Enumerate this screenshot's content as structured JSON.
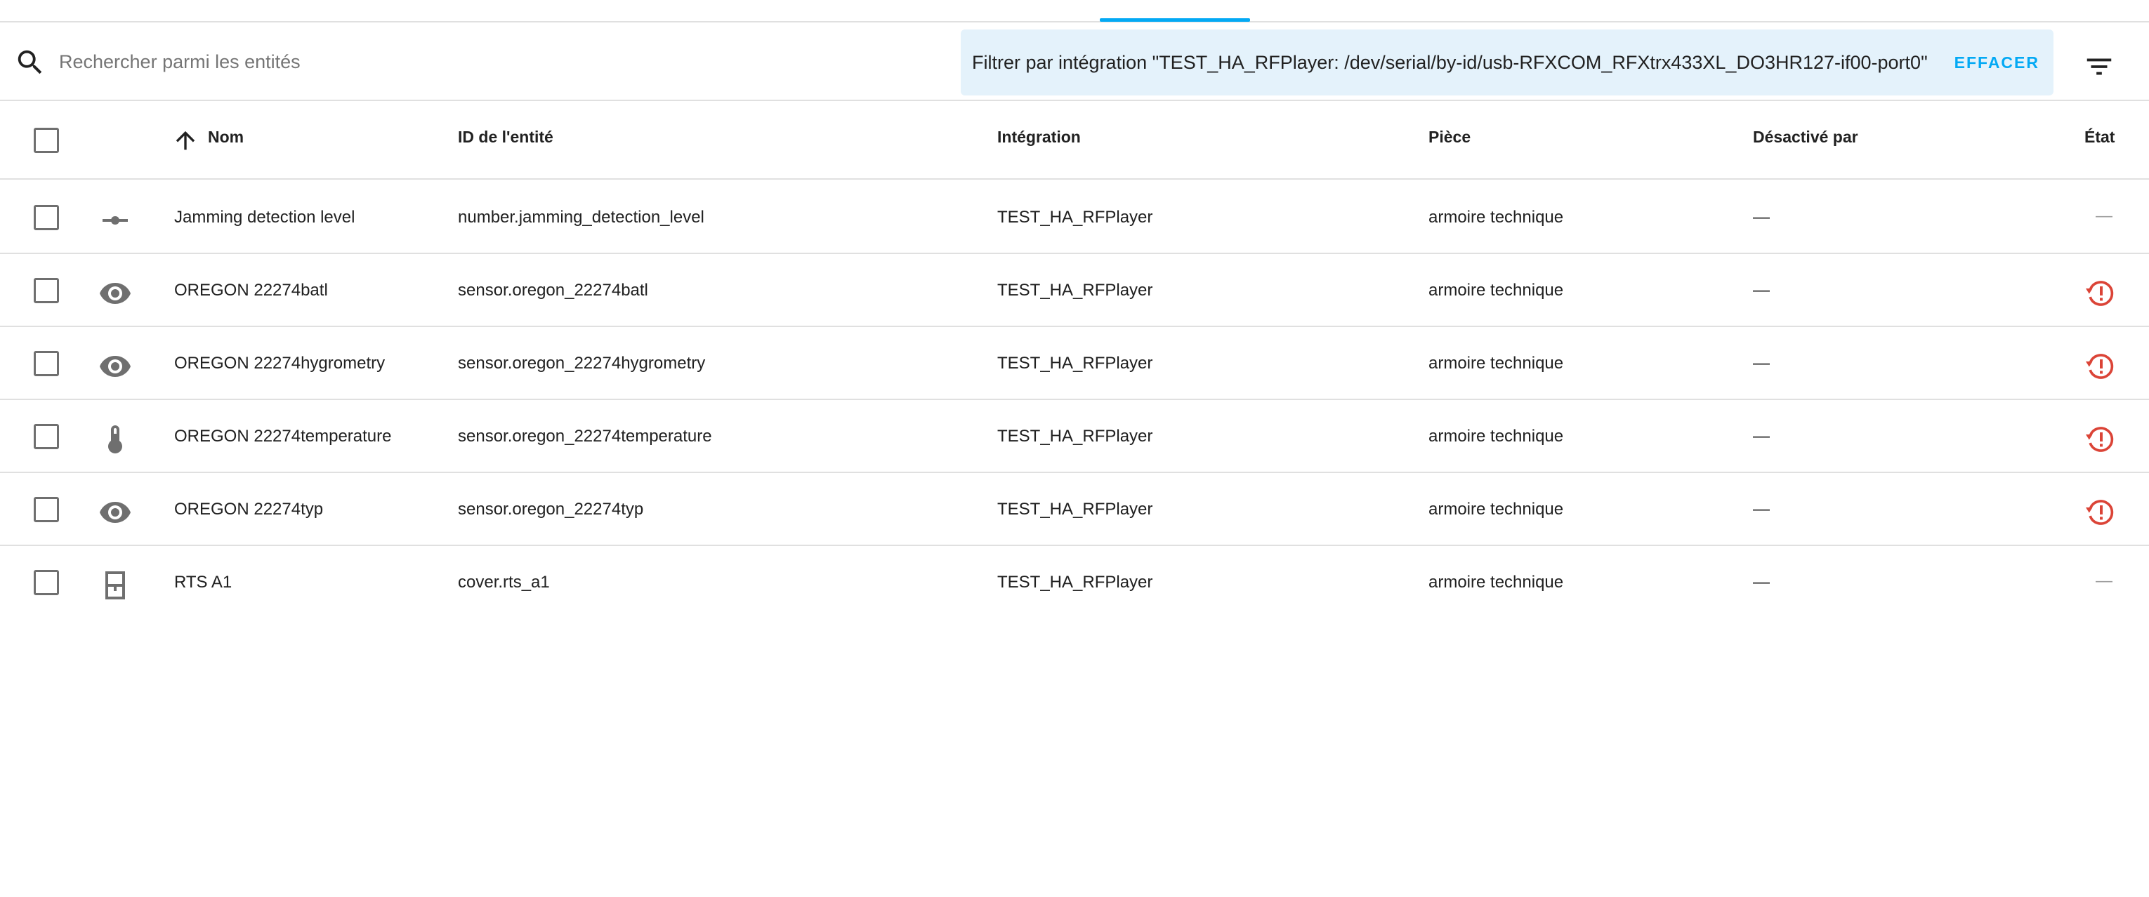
{
  "search": {
    "placeholder": "Rechercher parmi les entités",
    "filter_label": "Filtrer par intégration \"TEST_HA_RFPlayer: /dev/serial/by-id/usb-RFXCOM_RFXtrx433XL_DO3HR127-if00-port0\"",
    "clear_label": "EFFACER"
  },
  "table": {
    "headers": {
      "name": "Nom",
      "entity_id": "ID de l'entité",
      "integration": "Intégration",
      "area": "Pièce",
      "disabled_by": "Désactivé par",
      "status": "État"
    },
    "rows": [
      {
        "icon": "slider-icon",
        "name": "Jamming detection level",
        "entity_id": "number.jamming_detection_level",
        "integration": "TEST_HA_RFPlayer",
        "area": "armoire technique",
        "disabled_by": "—",
        "status": "—"
      },
      {
        "icon": "eye-icon",
        "name": "OREGON 22274batl",
        "entity_id": "sensor.oregon_22274batl",
        "integration": "TEST_HA_RFPlayer",
        "area": "armoire technique",
        "disabled_by": "—",
        "status": "restore-alert-icon"
      },
      {
        "icon": "eye-icon",
        "name": "OREGON 22274hygrometry",
        "entity_id": "sensor.oregon_22274hygrometry",
        "integration": "TEST_HA_RFPlayer",
        "area": "armoire technique",
        "disabled_by": "—",
        "status": "restore-alert-icon"
      },
      {
        "icon": "thermometer-icon",
        "name": "OREGON 22274temperature",
        "entity_id": "sensor.oregon_22274temperature",
        "integration": "TEST_HA_RFPlayer",
        "area": "armoire technique",
        "disabled_by": "—",
        "status": "restore-alert-icon"
      },
      {
        "icon": "eye-icon",
        "name": "OREGON 22274typ",
        "entity_id": "sensor.oregon_22274typ",
        "integration": "TEST_HA_RFPlayer",
        "area": "armoire technique",
        "disabled_by": "—",
        "status": "restore-alert-icon"
      },
      {
        "icon": "window-shutter-icon",
        "name": "RTS A1",
        "entity_id": "cover.rts_a1",
        "integration": "TEST_HA_RFPlayer",
        "area": "armoire technique",
        "disabled_by": "—",
        "status": "—"
      }
    ]
  },
  "colors": {
    "accent": "#03a9f4",
    "filter_chip_bg": "#e4f2fb",
    "icon_gray": "#6f6f6f",
    "alert_red": "#db4437"
  }
}
